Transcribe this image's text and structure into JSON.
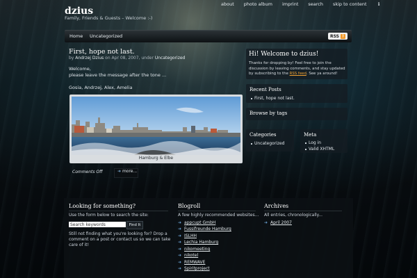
{
  "header": {
    "site_title": "dzius",
    "tagline": "Family, Friends & Guests – Welcome :-)",
    "nav": [
      "about",
      "photo album",
      "imprint",
      "search",
      "skip to content"
    ]
  },
  "menu": {
    "items": [
      "Home",
      "Uncategorized"
    ],
    "rss_label": "RSS"
  },
  "post": {
    "title": "First, hope not last.",
    "meta_by": "by",
    "author": "Andrzej Dzius",
    "meta_on": "on Apr 08, 2007, under",
    "category": "Uncategorized",
    "body_line1": "Welcome,",
    "body_line2": "please leave the message after the tone ...",
    "body_line3": "Gosia, Andrzej, Alex, Amelia",
    "photo_caption": "Hamburg & Elbe",
    "comments": "Comments Off",
    "more": "more..."
  },
  "sidebar": {
    "welcome_title": "Hi! Welcome to dzius!",
    "welcome_text1": "Thanks for dropping by! Feel free to join the discussion by leaving comments, and stay updated by subscribing to the",
    "welcome_link": "RSS feed",
    "welcome_text2": ". See ya around!",
    "recent_title": "Recent Posts",
    "recent_items": [
      "First, hope not last."
    ],
    "browse_title": "Browse by tags",
    "categories_title": "Categories",
    "categories_items": [
      "Uncategorized"
    ],
    "meta_title": "Meta",
    "meta_items": [
      "Log in",
      "Valid XHTML"
    ]
  },
  "footer": {
    "search_title": "Looking for something?",
    "search_text": "Use the form below to search the site:",
    "search_value": "Search keywords",
    "find_button": "Find It",
    "search_help": "Still not finding what you're looking for? Drop a comment on a post or contact us so we can take care of it!",
    "blogroll_title": "Blogroll",
    "blogroll_text": "A few highly recommended websites...",
    "blogroll_items": [
      "appcupt GmbH",
      "Fussifreunde Hamburg",
      "ISLHH",
      "Lechia Hamburg",
      "nikomeeting",
      "nikotel",
      "REMWAVE",
      "Spiritproject"
    ],
    "archives_title": "Archives",
    "archives_text": "All entries, chronologically...",
    "archives_items": [
      "April 2007"
    ]
  },
  "colors": {
    "accent_link": "#6aa2d4",
    "rss_orange": "#f29b2b"
  }
}
